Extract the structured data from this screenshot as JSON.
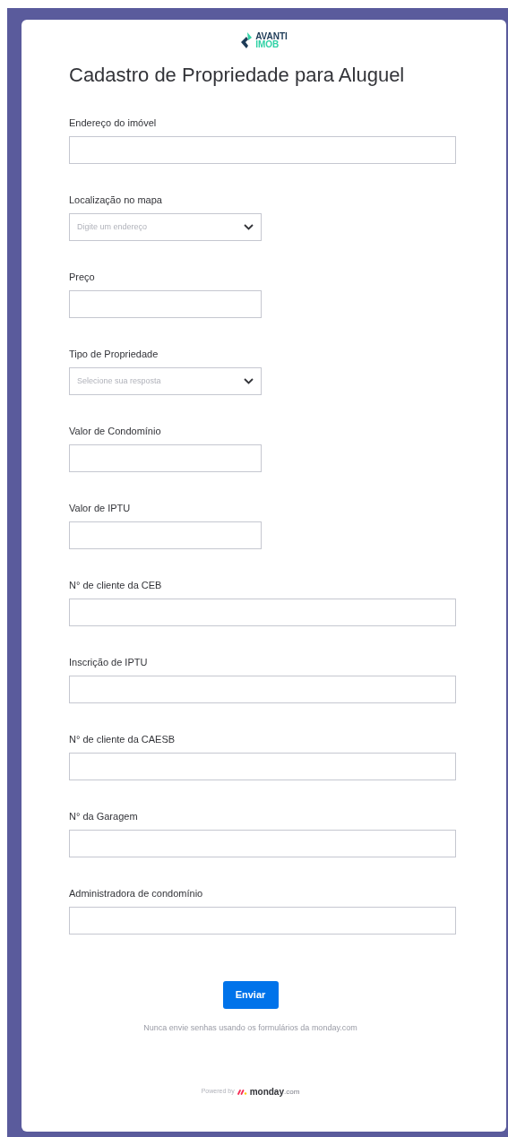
{
  "logo": {
    "line_1": "AVANTI",
    "line_2": "IMOB"
  },
  "title": "Cadastro de Propriedade para Aluguel",
  "fields": [
    {
      "kind": "long-text",
      "label": "Endereço do imóvel"
    },
    {
      "kind": "select",
      "label": "Localização no mapa",
      "placeholder": "Digite um endereço"
    },
    {
      "kind": "short-text",
      "label": "Preço"
    },
    {
      "kind": "select",
      "label": "Tipo de Propriedade",
      "placeholder": "Selecione sua resposta"
    },
    {
      "kind": "short-text",
      "label": "Valor de Condomínio"
    },
    {
      "kind": "short-text",
      "label": "Valor de IPTU"
    },
    {
      "kind": "long-text",
      "label": "N° de cliente da CEB"
    },
    {
      "kind": "long-text",
      "label": "Inscrição de IPTU"
    },
    {
      "kind": "long-text",
      "label": "N° de cliente da CAESB"
    },
    {
      "kind": "long-text",
      "label": "N° da Garagem"
    },
    {
      "kind": "long-text",
      "label": "Administradora de condomínio"
    }
  ],
  "submit_button": "Enviar",
  "notice": "Nunca envie senhas usando os formulários da monday.com",
  "powered_by": {
    "prefix": "Powered by",
    "brand": "monday",
    "suffix": ".com"
  }
}
